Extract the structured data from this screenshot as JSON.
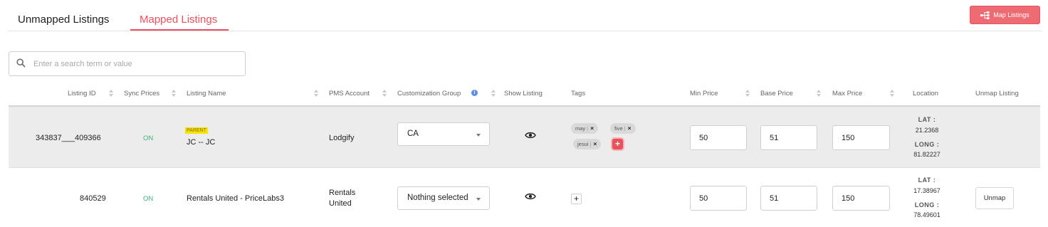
{
  "tabs": [
    {
      "label": "Unmapped Listings",
      "active": false
    },
    {
      "label": "Mapped Listings",
      "active": true
    }
  ],
  "map_button": {
    "label": "Map Listings",
    "icon": "sitemap-icon",
    "color": "#ee6b73"
  },
  "search": {
    "placeholder": "Enter a search term or value",
    "value": "",
    "icon": "search-icon"
  },
  "columns": {
    "listing_id": "Listing ID",
    "sync_prices": "Sync Prices",
    "listing_name": "Listing Name",
    "pms_account": "PMS Account",
    "customization_group": "Customization Group",
    "show_listing": "Show Listing",
    "tags": "Tags",
    "min_price": "Min Price",
    "base_price": "Base Price",
    "max_price": "Max Price",
    "location": "Location",
    "unmap_listing": "Unmap Listing"
  },
  "rows": [
    {
      "listing_id": "343837___409366",
      "sync": "ON",
      "badge": "PARENT",
      "name": "JC -- JC",
      "pms": "Lodgify",
      "group": "CA",
      "show_icon": "eye-icon",
      "tags": [
        "may",
        "five",
        "jesui"
      ],
      "min": "50",
      "base": "51",
      "max": "150",
      "lat_label": "LAT :",
      "lat": "21.2368",
      "long_label": "LONG :",
      "long": "81.82227"
    },
    {
      "listing_id": "840529",
      "sync": "ON",
      "name": "Rentals United - PriceLabs3",
      "pms_line1": "Rentals",
      "pms_line2": "United",
      "group": "Nothing selected",
      "show_icon": "eye-icon",
      "tags": [],
      "min": "50",
      "base": "51",
      "max": "150",
      "lat_label": "LAT :",
      "lat": "17.38967",
      "long_label": "LONG :",
      "long": "78.49601",
      "unmap_label": "Unmap"
    }
  ],
  "colors": {
    "accent": "#e8505b",
    "on": "#3fb37a",
    "parent_badge": "#f5e400"
  }
}
